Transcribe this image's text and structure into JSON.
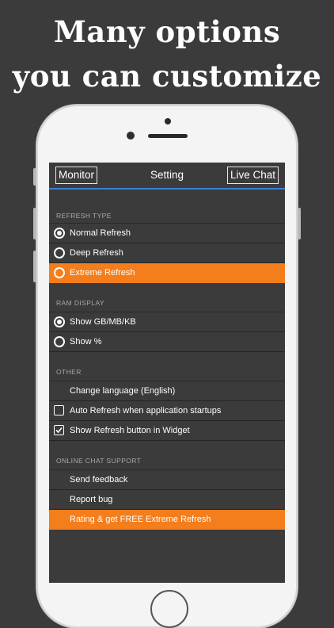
{
  "promo": {
    "line1": "Many options",
    "line2": "you can customize"
  },
  "navbar": {
    "left_button": "Monitor",
    "title": "Setting",
    "right_button": "Live Chat"
  },
  "sections": {
    "refresh_type": {
      "header": "REFRESH TYPE",
      "items": [
        {
          "label": "Normal Refresh",
          "control": "radio",
          "checked": true
        },
        {
          "label": "Deep Refresh",
          "control": "radio",
          "checked": false
        },
        {
          "label": "Extreme Refresh",
          "control": "radio",
          "checked": false,
          "highlight": true
        }
      ]
    },
    "ram_display": {
      "header": "RAM DISPLAY",
      "items": [
        {
          "label": "Show GB/MB/KB",
          "control": "radio",
          "checked": true
        },
        {
          "label": "Show %",
          "control": "radio",
          "checked": false
        }
      ]
    },
    "other": {
      "header": "OTHER",
      "items": [
        {
          "label": "Change language (English)",
          "control": "none"
        },
        {
          "label": "Auto Refresh when application startups",
          "control": "checkbox",
          "checked": false
        },
        {
          "label": "Show Refresh button in Widget",
          "control": "checkbox",
          "checked": true
        }
      ]
    },
    "online_chat": {
      "header": "ONLINE CHAT SUPPORT",
      "items": [
        {
          "label": "Send feedback",
          "control": "none"
        },
        {
          "label": "Report bug",
          "control": "none"
        },
        {
          "label": "Rating & get FREE Extreme Refresh",
          "control": "none",
          "highlight": true
        }
      ]
    }
  },
  "colors": {
    "background": "#3b3b3b",
    "accent_orange": "#f47d1c",
    "navbar_underline": "#3b7fd4"
  }
}
